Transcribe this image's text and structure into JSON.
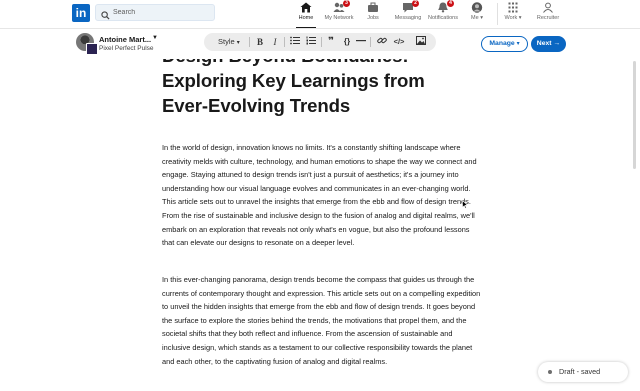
{
  "nav": {
    "logo": "in",
    "search_placeholder": "Search",
    "items": [
      {
        "label": "Home",
        "icon": "home-icon",
        "badge": ""
      },
      {
        "label": "My Network",
        "icon": "network-icon",
        "badge": "3"
      },
      {
        "label": "Jobs",
        "icon": "briefcase-icon",
        "badge": ""
      },
      {
        "label": "Messaging",
        "icon": "messaging-icon",
        "badge": "2"
      },
      {
        "label": "Notifications",
        "icon": "bell-icon",
        "badge": "4"
      },
      {
        "label": "Me",
        "icon": "avatar-icon",
        "badge": ""
      },
      {
        "label": "Work",
        "icon": "grid-icon",
        "badge": ""
      },
      {
        "label": "Recruiter",
        "icon": "recruiter-icon",
        "badge": ""
      }
    ],
    "active": "Home",
    "accent_color": "#0a66c2",
    "badge_color": "#cc1016"
  },
  "editor": {
    "author_name": "Antoine Mart...",
    "page_name": "Pixel Perfect Pulse",
    "style_label": "Style",
    "tools": [
      "bold-icon",
      "italic-icon",
      "bulleted-list-icon",
      "numbered-list-icon",
      "quote-icon",
      "code-block-icon",
      "divider-icon",
      "link-icon",
      "embed-code-icon",
      "image-icon"
    ],
    "manage_label": "Manage",
    "next_label": "Next"
  },
  "article": {
    "title": "Design Beyond Boundaries: Exploring Key Learnings from Ever-Evolving Trends",
    "paragraphs": [
      "In the world of design, innovation knows no limits. It's a constantly shifting landscape where creativity melds with culture, technology, and human emotions to shape the way we connect and engage. Staying attuned to design trends isn't just a pursuit of aesthetics; it's a journey into understanding how our visual language evolves and communicates in an ever-changing world. This article sets out to unravel the insights that emerge from the ebb and flow of design trends. From the rise of sustainable and inclusive design to the fusion of analog and digital realms, we'll embark on an exploration that reveals not only what's en vogue, but also the profound lessons that can elevate our designs to resonate on a deeper level.",
      "In this ever-changing panorama, design trends become the compass that guides us through the currents of contemporary thought and expression. This article sets out on a compelling expedition to unveil the hidden insights that emerge from the ebb and flow of design trends. It goes beyond the surface to explore the stories behind the trends, the motivations that propel them, and the societal shifts that they both reflect and influence. From the ascension of sustainable and inclusive design, which stands as a testament to our collective responsibility towards the planet and each other, to the captivating fusion of analog and digital realms."
    ]
  },
  "status": {
    "draft_label": "Draft - saved"
  }
}
